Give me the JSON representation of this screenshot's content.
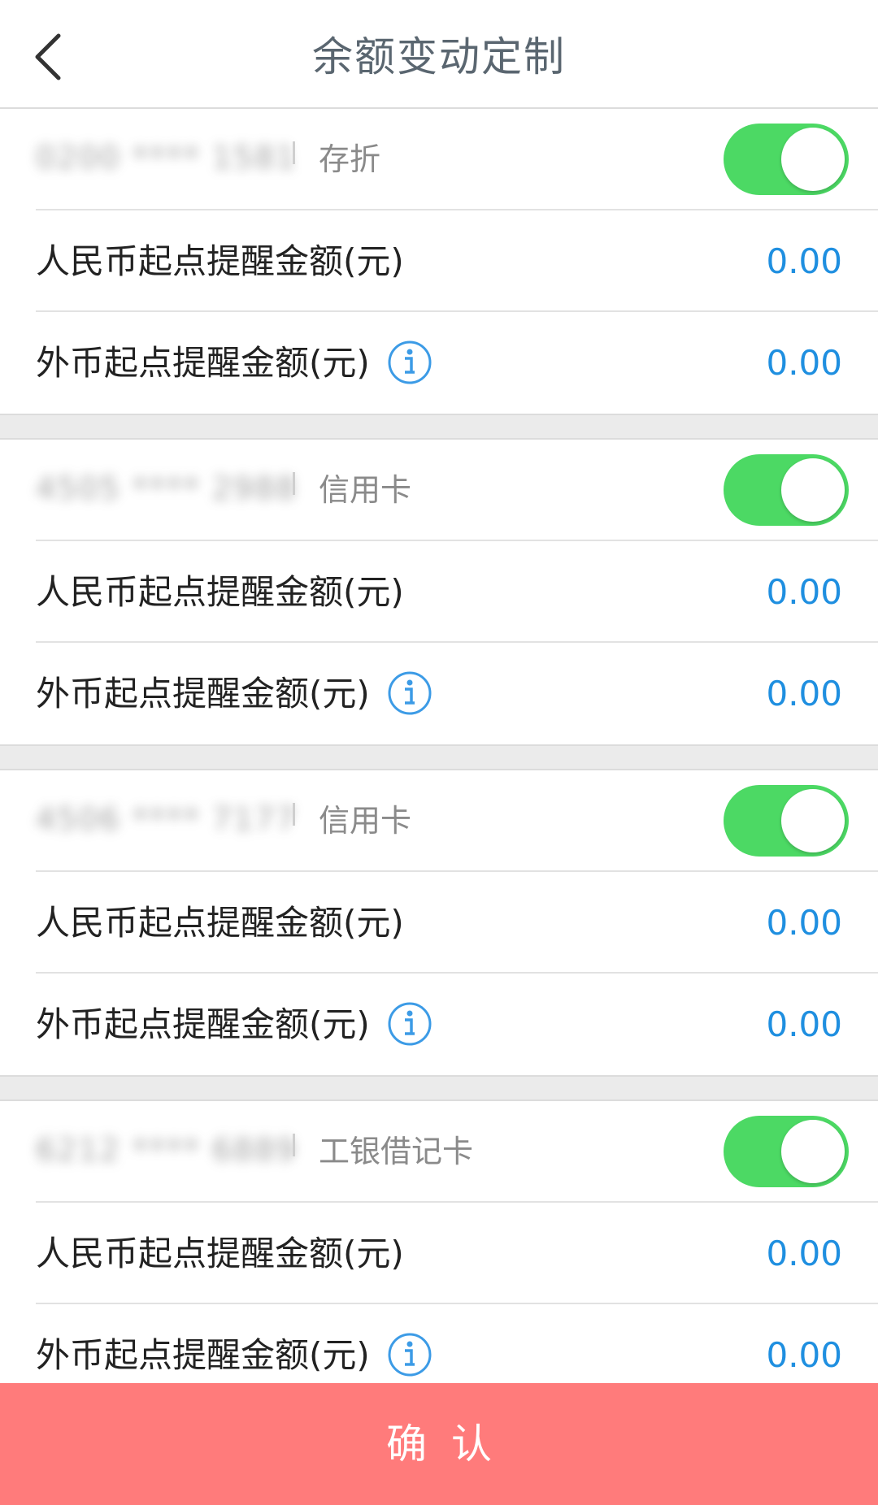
{
  "header": {
    "title": "余额变动定制",
    "back_icon": "chevron-left-icon"
  },
  "accounts": [
    {
      "account_number": "0200 **** 1581",
      "type": "存折",
      "enabled": true,
      "rmb_label": "人民币起点提醒金额(元)",
      "rmb_value": "0.00",
      "fx_label": "外币起点提醒金额(元)",
      "fx_value": "0.00"
    },
    {
      "account_number": "4505 **** 2988",
      "type": "信用卡",
      "enabled": true,
      "rmb_label": "人民币起点提醒金额(元)",
      "rmb_value": "0.00",
      "fx_label": "外币起点提醒金额(元)",
      "fx_value": "0.00"
    },
    {
      "account_number": "4506 **** 7177",
      "type": "信用卡",
      "enabled": true,
      "rmb_label": "人民币起点提醒金额(元)",
      "rmb_value": "0.00",
      "fx_label": "外币起点提醒金额(元)",
      "fx_value": "0.00"
    },
    {
      "account_number": "6212 **** 6889",
      "type": "工银借记卡",
      "enabled": true,
      "rmb_label": "人民币起点提醒金额(元)",
      "rmb_value": "0.00",
      "fx_label": "外币起点提醒金额(元)",
      "fx_value": "0.00"
    }
  ],
  "confirm_label": "确认",
  "colors": {
    "toggle_on": "#4cd964",
    "amount": "#1f8fe0",
    "confirm_bg": "#ff7b7b",
    "info_icon": "#3c9be6"
  }
}
